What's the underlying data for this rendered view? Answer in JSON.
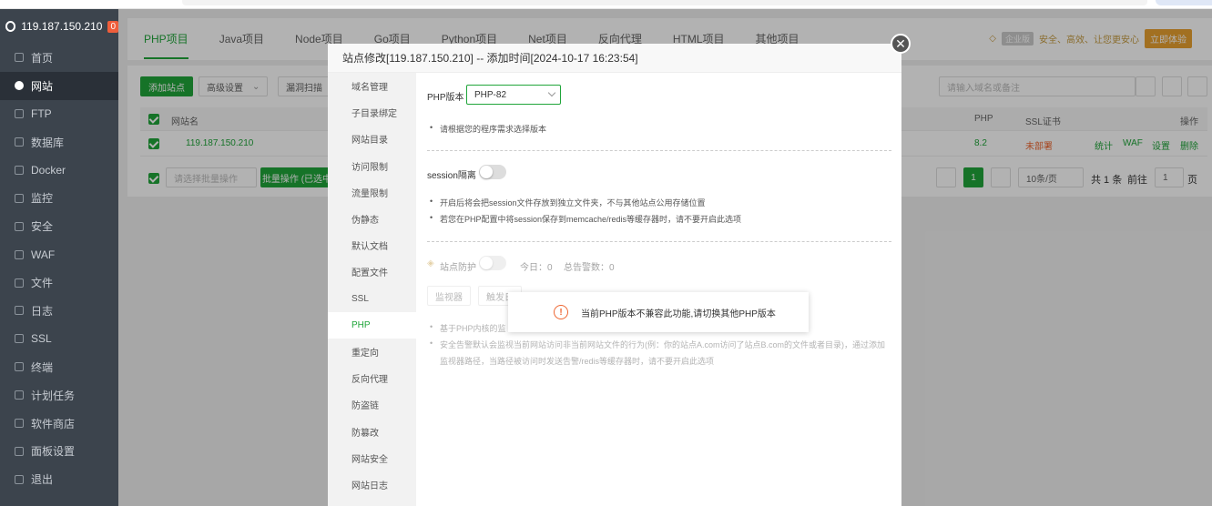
{
  "sidebar": {
    "server_ip": "119.187.150.210",
    "badge": "0",
    "items": [
      {
        "label": "首页",
        "icon": "home-icon"
      },
      {
        "label": "网站",
        "icon": "globe-icon"
      },
      {
        "label": "FTP",
        "icon": "ftp-icon"
      },
      {
        "label": "数据库",
        "icon": "database-icon"
      },
      {
        "label": "Docker",
        "icon": "docker-icon"
      },
      {
        "label": "监控",
        "icon": "monitor-icon"
      },
      {
        "label": "安全",
        "icon": "shield-icon"
      },
      {
        "label": "WAF",
        "icon": "waf-icon"
      },
      {
        "label": "文件",
        "icon": "folder-icon"
      },
      {
        "label": "日志",
        "icon": "log-icon"
      },
      {
        "label": "SSL",
        "icon": "ssl-icon"
      },
      {
        "label": "终端",
        "icon": "terminal-icon"
      },
      {
        "label": "计划任务",
        "icon": "calendar-icon"
      },
      {
        "label": "软件商店",
        "icon": "store-icon"
      },
      {
        "label": "面板设置",
        "icon": "settings-icon"
      },
      {
        "label": "退出",
        "icon": "logout-icon"
      }
    ]
  },
  "tabs": [
    "PHP项目",
    "Java项目",
    "Node项目",
    "Go项目",
    "Python项目",
    "Net项目",
    "反向代理",
    "HTML项目",
    "其他项目"
  ],
  "promo": {
    "vip": "企业版",
    "text": "安全、高效、让您更安心",
    "try": "立即体验"
  },
  "toolbar": {
    "add_site": "添加站点",
    "advanced": "高级设置",
    "scan": "漏洞扫描",
    "search_placeholder": "请输入域名或备注"
  },
  "table": {
    "headers": {
      "name": "网站名",
      "php": "PHP",
      "ssl": "SSL证书",
      "ops": "操作"
    },
    "rows": [
      {
        "name": "119.187.150.210",
        "php": "8.2",
        "ssl": "未部署",
        "actions": [
          "统计",
          "WAF",
          "设置",
          "删除"
        ]
      }
    ]
  },
  "footer": {
    "batch_placeholder": "请选择批量操作",
    "batch_btn": "批量操作 (已选中",
    "page": "1",
    "per_page": "10条/页",
    "total": "共 1 条",
    "goto_label": "前往",
    "goto_value": "1",
    "page_suffix": "页"
  },
  "dialog": {
    "title": "站点修改[119.187.150.210] -- 添加时间[2024-10-17 16:23:54]",
    "nav": [
      "域名管理",
      "子目录绑定",
      "网站目录",
      "访问限制",
      "流量限制",
      "伪静态",
      "默认文档",
      "配置文件",
      "SSL",
      "PHP",
      "重定向",
      "反向代理",
      "防盗链",
      "防篡改",
      "网站安全",
      "网站日志"
    ],
    "active_nav": "PHP",
    "php_version_label": "PHP版本",
    "php_version_value": "PHP-82",
    "php_tip": "请根据您的程序需求选择版本",
    "session_label": "session隔离",
    "session_tips": [
      "开启后将会把session文件存放到独立文件夹，不与其他站点公用存储位置",
      "若您在PHP配置中将session保存到memcache/redis等缓存器时，请不要开启此选项"
    ],
    "protect_label": "站点防护",
    "today_label": "今日：0",
    "total_alarm_label": "总告警数：0",
    "monitor_btn": "监视器",
    "trigger_btn": "触发日",
    "protect_tips": [
      "基于PHP内核的监",
      "安全告警默认会监视当前网站访问非当前网站文件的行为(例：你的站点A.com访问了站点B.com的文件或者目录)，通过添加",
      "监视器路径，当路径被访问时发送告警/redis等缓存器时，请不要开启此选项"
    ]
  },
  "toast": {
    "message": "当前PHP版本不兼容此功能,请切换其他PHP版本"
  },
  "colors": {
    "accent": "#20a53a",
    "sidebar": "#3c444d",
    "warning": "#ee6732"
  }
}
